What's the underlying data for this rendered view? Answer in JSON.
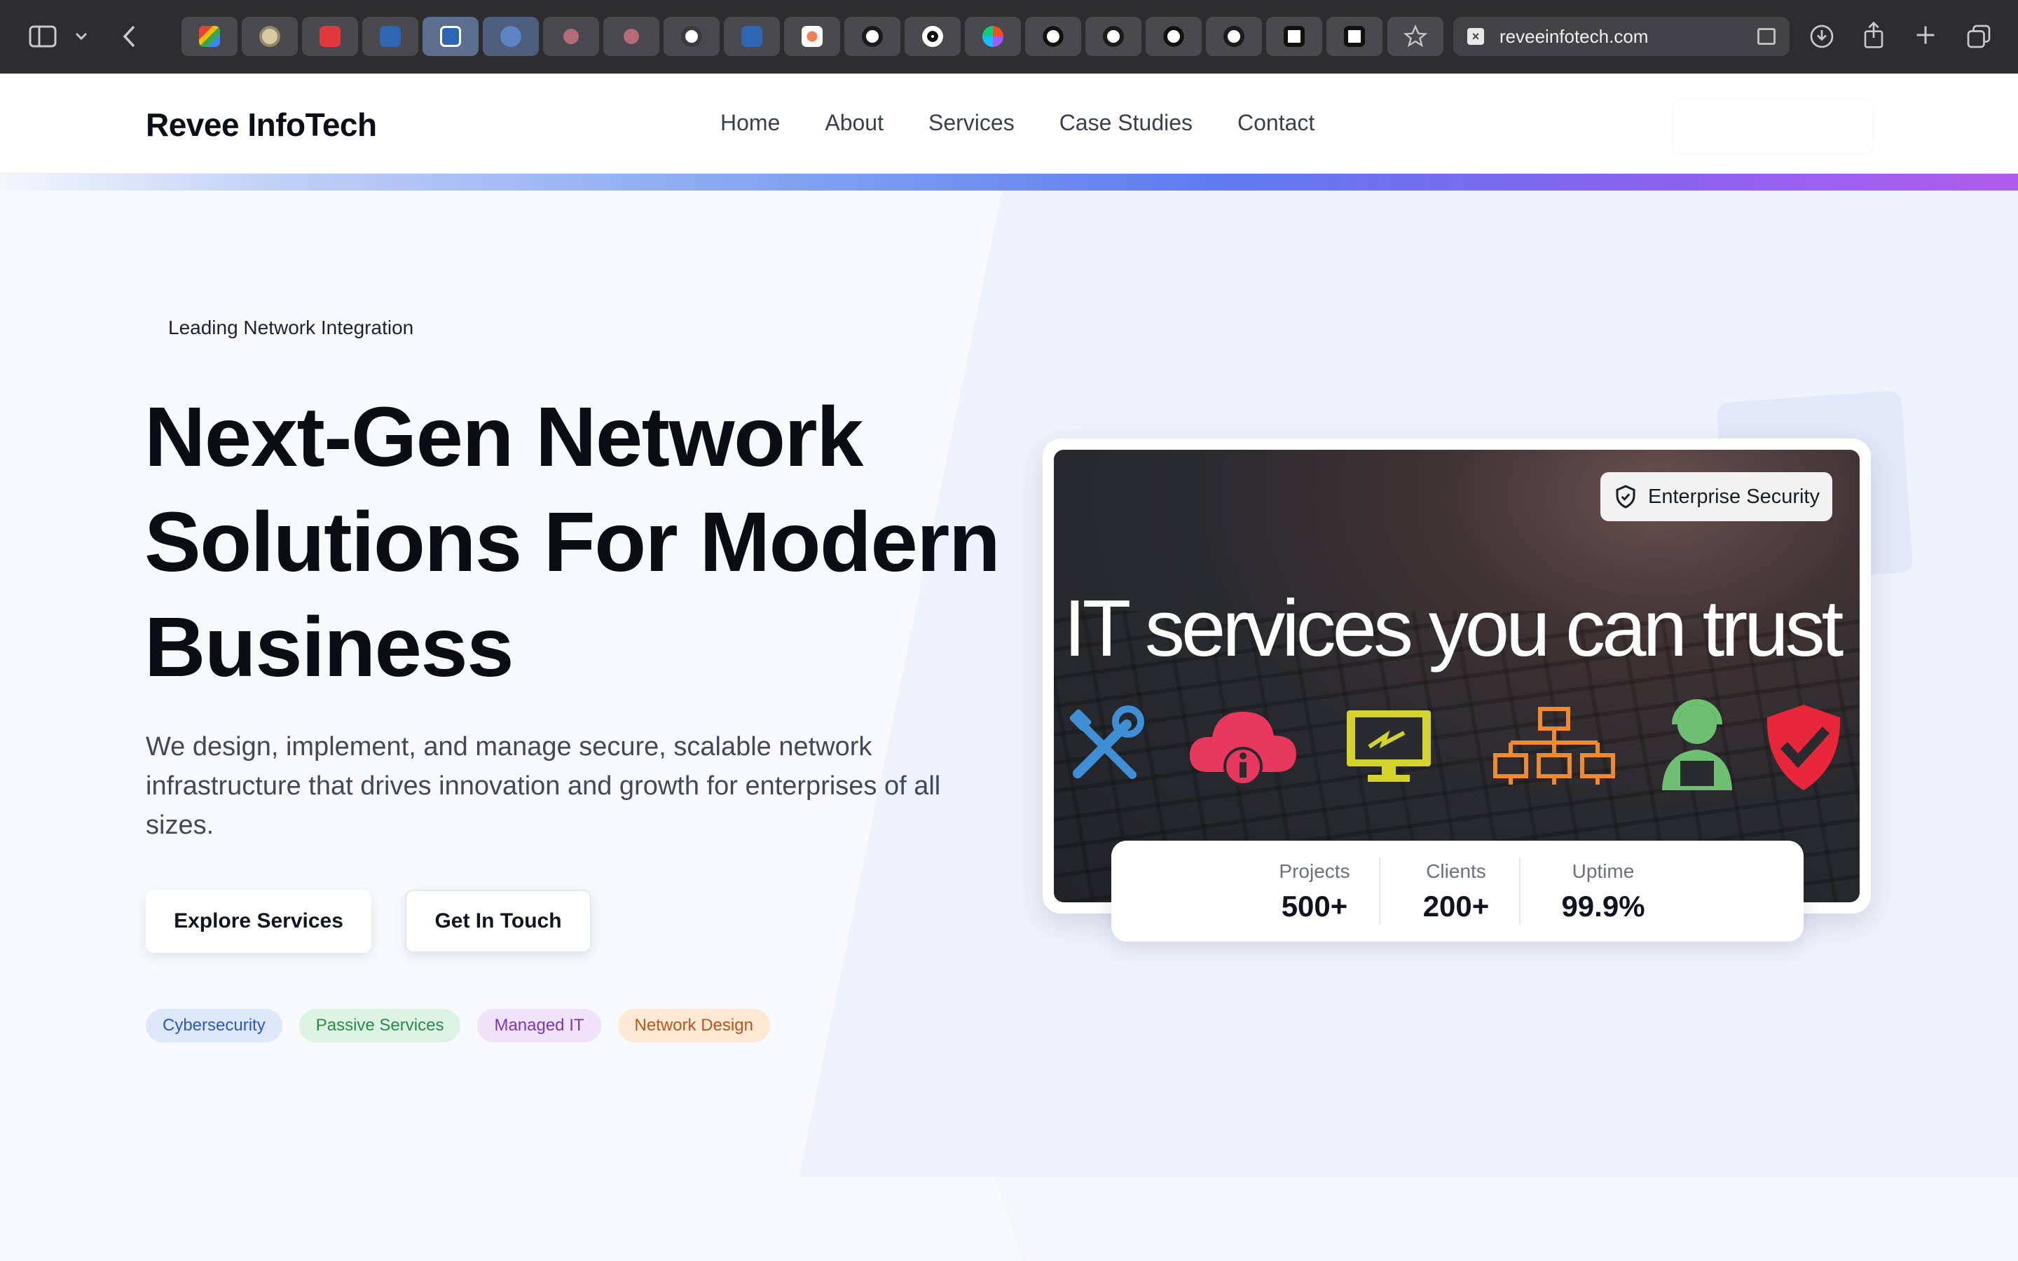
{
  "browser": {
    "url": "reveeinfotech.com",
    "tab_favicons": [
      "gmail-icon",
      "avatar-icon",
      "red-app-icon",
      "linkedin-icon",
      "linkedin-icon",
      "blue-circle-icon",
      "avatar-icon",
      "avatar-icon",
      "swirl-icon",
      "linkedin-icon",
      "starburst-icon",
      "github-icon",
      "triangle-icon",
      "figma-icon",
      "triangle-icon",
      "github-icon",
      "triangle-icon",
      "github-icon",
      "cube-icon",
      "cube-icon"
    ]
  },
  "header": {
    "brand": "Revee InfoTech",
    "nav": [
      "Home",
      "About",
      "Services",
      "Case Studies",
      "Contact"
    ]
  },
  "hero": {
    "eyebrow": "Leading Network Integration",
    "title": "Next-Gen Network Solutions For Modern Business",
    "subtitle": "We design, implement, and manage secure, scalable network infrastructure that drives innovation and growth for enterprises of all sizes.",
    "buttons": {
      "primary": "Explore Services",
      "secondary": "Get In Touch"
    },
    "tags": [
      "Cybersecurity",
      "Passive Services",
      "Managed IT",
      "Network Design"
    ]
  },
  "card": {
    "image_headline": "IT services you can trust",
    "badge": "Enterprise Security",
    "stats": [
      {
        "label": "Projects",
        "value": "500+"
      },
      {
        "label": "Clients",
        "value": "200+"
      },
      {
        "label": "Uptime",
        "value": "99.9%"
      }
    ]
  },
  "colors": {
    "tag_blue": "#2c56c7",
    "tag_green": "#2b8a4b",
    "tag_purple": "#7a35b8",
    "tag_orange": "#b8561d",
    "gradient_start": "#7fa1f1",
    "gradient_end": "#b05ced"
  }
}
